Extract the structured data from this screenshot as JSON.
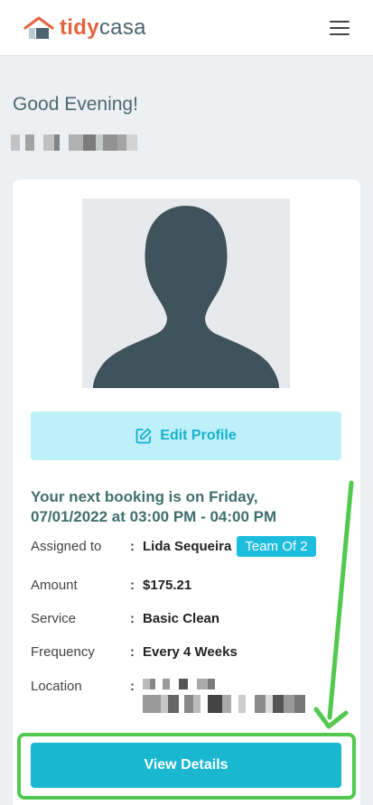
{
  "header": {
    "logo_tidy": "tidy",
    "logo_casa": "casa",
    "menu_icon": "hamburger-menu-icon"
  },
  "greeting": "Good Evening!",
  "profile": {
    "avatar_icon": "user-silhouette-icon",
    "edit_label": "Edit Profile",
    "edit_icon": "edit-pencil-icon"
  },
  "booking": {
    "title": "Your next booking is on Friday, 07/01/2022 at 03:00 PM - 04:00 PM",
    "fields": [
      {
        "label": "Assigned to",
        "value": "Lida Sequeira",
        "badge": "Team Of 2"
      },
      {
        "label": "Amount",
        "value": "$175.21"
      },
      {
        "label": "Service",
        "value": "Basic Clean"
      },
      {
        "label": "Frequency",
        "value": "Every 4 Weeks"
      },
      {
        "label": "Location",
        "value": ""
      }
    ],
    "colon": ":"
  },
  "actions": {
    "view_details": "View Details"
  },
  "colors": {
    "brand_orange": "#e2643f",
    "brand_slate": "#4b6470",
    "accent_cyan": "#19b7d0",
    "highlight_green": "#51c94f"
  }
}
